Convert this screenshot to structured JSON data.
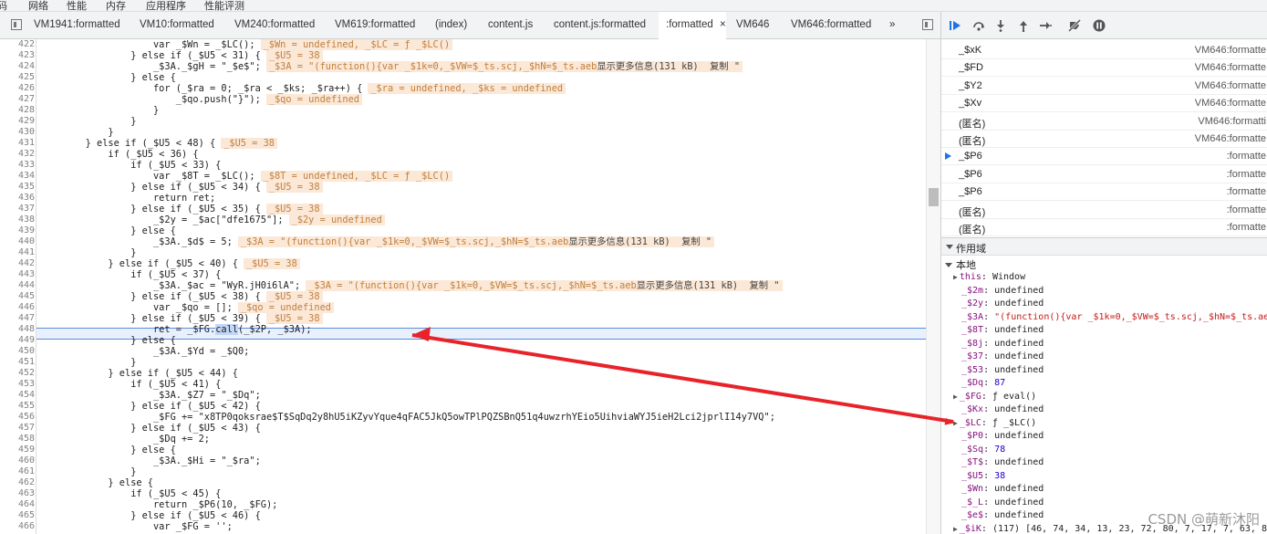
{
  "top_menu": [
    "码",
    "网络",
    "性能",
    "内存",
    "应用程序",
    "性能评测"
  ],
  "tabs": [
    {
      "label": "VM1941:formatted"
    },
    {
      "label": "VM10:formatted"
    },
    {
      "label": "VM240:formatted"
    },
    {
      "label": "VM619:formatted"
    },
    {
      "label": "(index)"
    },
    {
      "label": "content.js"
    },
    {
      "label": "content.js:formatted"
    },
    {
      "label": ":formatted",
      "close": "×"
    },
    {
      "label": "VM646"
    },
    {
      "label": "VM646:formatted"
    },
    {
      "label": "»"
    }
  ],
  "code_lines": [
    {
      "n": "422",
      "t": "                    var _$Wn = _$LC();",
      "i": "_$Wn = undefined, _$LC = ƒ _$LC()"
    },
    {
      "n": "423",
      "t": "                } else if (_$U5 < 31) {",
      "i": "_$U5 = 38"
    },
    {
      "n": "424",
      "t": "                    _$3A._$gH = \"_$e$\";",
      "i": "_$3A = \"(function(){var _$1k=0,_$VW=$_ts.scj,_$hN=$_ts.aeb",
      "more": "显示更多信息(131 kB)  复制 \""
    },
    {
      "n": "425",
      "t": "                } else {",
      "i": ""
    },
    {
      "n": "426",
      "t": "                    for (_$ra = 0; _$ra < _$ks; _$ra++) {",
      "i": "_$ra = undefined, _$ks = undefined"
    },
    {
      "n": "427",
      "t": "                        _$qo.push(\"}\");",
      "i": "_$qo = undefined"
    },
    {
      "n": "428",
      "t": "                    }",
      "i": ""
    },
    {
      "n": "429",
      "t": "                }",
      "i": ""
    },
    {
      "n": "430",
      "t": "            }",
      "i": ""
    },
    {
      "n": "431",
      "t": "        } else if (_$U5 < 48) {",
      "i": "_$U5 = 38"
    },
    {
      "n": "432",
      "t": "            if (_$U5 < 36) {",
      "i": ""
    },
    {
      "n": "433",
      "t": "                if (_$U5 < 33) {",
      "i": ""
    },
    {
      "n": "434",
      "t": "                    var _$8T = _$LC();",
      "i": "_$8T = undefined, _$LC = ƒ _$LC()"
    },
    {
      "n": "435",
      "t": "                } else if (_$U5 < 34) {",
      "i": "_$U5 = 38"
    },
    {
      "n": "436",
      "t": "                    return ret;",
      "i": ""
    },
    {
      "n": "437",
      "t": "                } else if (_$U5 < 35) {",
      "i": "_$U5 = 38"
    },
    {
      "n": "438",
      "t": "                    _$2y = _$ac[\"dfe1675\"];",
      "i": "_$2y = undefined"
    },
    {
      "n": "439",
      "t": "                } else {",
      "i": ""
    },
    {
      "n": "440",
      "t": "                    _$3A._$d$ = 5;",
      "i": "_$3A = \"(function(){var _$1k=0,_$VW=$_ts.scj,_$hN=$_ts.aeb",
      "more": "显示更多信息(131 kB)  复制 \""
    },
    {
      "n": "441",
      "t": "                }",
      "i": ""
    },
    {
      "n": "442",
      "t": "            } else if (_$U5 < 40) {",
      "i": "_$U5 = 38"
    },
    {
      "n": "443",
      "t": "                if (_$U5 < 37) {",
      "i": ""
    },
    {
      "n": "444",
      "t": "                    _$3A._$ac = \"WyR.jH0i6lA\";",
      "i": "_$3A = \"(function(){var _$1k=0,_$VW=$_ts.scj,_$hN=$_ts.aeb",
      "more": "显示更多信息(131 kB)  复制 \""
    },
    {
      "n": "445",
      "t": "                } else if (_$U5 < 38) {",
      "i": "_$U5 = 38"
    },
    {
      "n": "446",
      "t": "                    var _$qo = [];",
      "i": "_$qo = undefined"
    },
    {
      "n": "447",
      "t": "                } else if (_$U5 < 39) {",
      "i": "_$U5 = 38"
    },
    {
      "n": "448",
      "t": "                    ret = _$FG.call(_$2P, _$3A);",
      "i": "",
      "highlight": true
    },
    {
      "n": "449",
      "t": "                } else {",
      "i": ""
    },
    {
      "n": "450",
      "t": "                    _$3A._$Yd = _$Q0;",
      "i": ""
    },
    {
      "n": "451",
      "t": "                }",
      "i": ""
    },
    {
      "n": "452",
      "t": "            } else if (_$U5 < 44) {",
      "i": ""
    },
    {
      "n": "453",
      "t": "                if (_$U5 < 41) {",
      "i": ""
    },
    {
      "n": "454",
      "t": "                    _$3A._$Z7 = \"_$Dq\";",
      "i": ""
    },
    {
      "n": "455",
      "t": "                } else if (_$U5 < 42) {",
      "i": ""
    },
    {
      "n": "456",
      "t": "                    _$FG += \"x8TP0qoksrae$T$SqDq2y8hU5iKZyvYque4qFAC5JkQ5owTPlPQZSBnQ51q4uwzrhYEio5UihviaWYJ5ieH2Lci2jprlI14y7VQ\";",
      "i": ""
    },
    {
      "n": "457",
      "t": "                } else if (_$U5 < 43) {",
      "i": ""
    },
    {
      "n": "458",
      "t": "                    _$Dq += 2;",
      "i": ""
    },
    {
      "n": "459",
      "t": "                } else {",
      "i": ""
    },
    {
      "n": "460",
      "t": "                    _$3A._$Hi = \"_$ra\";",
      "i": ""
    },
    {
      "n": "461",
      "t": "                }",
      "i": ""
    },
    {
      "n": "462",
      "t": "            } else {",
      "i": ""
    },
    {
      "n": "463",
      "t": "                if (_$U5 < 45) {",
      "i": ""
    },
    {
      "n": "464",
      "t": "                    return _$P6(10, _$FG);",
      "i": ""
    },
    {
      "n": "465",
      "t": "                } else if (_$U5 < 46) {",
      "i": ""
    },
    {
      "n": "466",
      "t": "                    var _$FG = '';",
      "i": ""
    }
  ],
  "debug_toolbar": [
    "resume-icon",
    "step-over-icon",
    "step-into-icon",
    "step-out-icon",
    "step-icon",
    "deactivate-breakpoints-icon",
    "pause-on-exceptions-icon"
  ],
  "call_stack": [
    {
      "name": "_$xK",
      "loc": "VM646:formatte"
    },
    {
      "name": "_$FD",
      "loc": "VM646:formatte"
    },
    {
      "name": "_$Y2",
      "loc": "VM646:formatte"
    },
    {
      "name": "_$Xv",
      "loc": "VM646:formatte"
    },
    {
      "name": "(匿名)",
      "loc": "VM646:formatti"
    },
    {
      "name": "(匿名)",
      "loc": "VM646:formatte"
    },
    {
      "name": "_$P6",
      "loc": ":formatte",
      "current": true
    },
    {
      "name": "_$P6",
      "loc": ":formatte"
    },
    {
      "name": "_$P6",
      "loc": ":formatte"
    },
    {
      "name": "(匿名)",
      "loc": ":formatte"
    },
    {
      "name": "(匿名)",
      "loc": ":formatte"
    }
  ],
  "scope_header": "作用域",
  "local_header": "本地",
  "scope_vars": [
    {
      "k": "this",
      "v": "Window",
      "expand": true
    },
    {
      "k": "_$2m",
      "v": "undefined"
    },
    {
      "k": "_$2y",
      "v": "undefined"
    },
    {
      "k": "_$3A",
      "v": "\"(function(){var _$1k=0,_$VW=$_ts.scj,_$hN=$_ts.aeb",
      "str": true
    },
    {
      "k": "_$8T",
      "v": "undefined"
    },
    {
      "k": "_$8j",
      "v": "undefined"
    },
    {
      "k": "_$37",
      "v": "undefined"
    },
    {
      "k": "_$53",
      "v": "undefined"
    },
    {
      "k": "_$Dq",
      "v": "87",
      "num": true
    },
    {
      "k": "_$FG",
      "v": "ƒ eval()",
      "expand": true
    },
    {
      "k": "_$Kx",
      "v": "undefined"
    },
    {
      "k": "_$LC",
      "v": "ƒ _$LC()",
      "expand": true
    },
    {
      "k": "_$P0",
      "v": "undefined"
    },
    {
      "k": "_$Sq",
      "v": "78",
      "num": true
    },
    {
      "k": "_$T$",
      "v": "undefined"
    },
    {
      "k": "_$U5",
      "v": "38",
      "num": true
    },
    {
      "k": "_$Wn",
      "v": "undefined"
    },
    {
      "k": "_$_L",
      "v": "undefined"
    },
    {
      "k": "_$e$",
      "v": "undefined"
    },
    {
      "k": "_$iK",
      "v": "(117) [46, 74, 34, 13, 23, 72, 80, 7, 17, 7, 63, 84",
      "expand": true
    }
  ],
  "watermark": "CSDN @萌新沐阳",
  "colors": {
    "arrow": "#e8232a",
    "accent": "#1a73e8",
    "inline_bg": "#fbe8d7"
  }
}
